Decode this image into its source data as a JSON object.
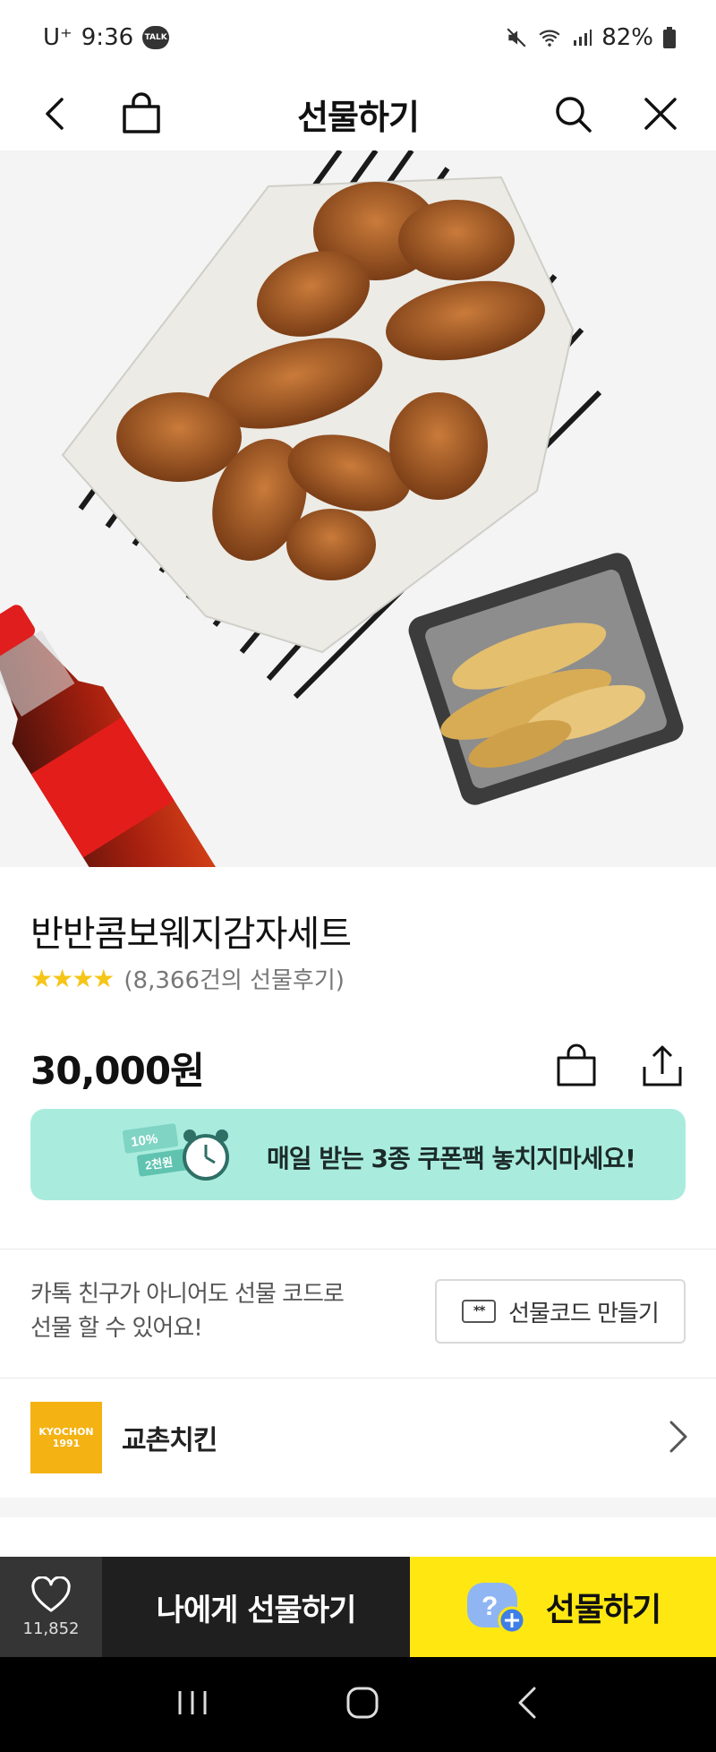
{
  "status_bar": {
    "carrier": "U⁺",
    "time": "9:36",
    "talk_badge": "TALK",
    "battery": "82%"
  },
  "header": {
    "title": "선물하기"
  },
  "product": {
    "name": "반반콤보웨지감자세트",
    "stars": "★★★★",
    "review_count": "(8,366건의 선물후기)",
    "price": "30,000원"
  },
  "coupon": {
    "text": "매일 받는 3종 쿠폰팩 놓치지마세요!",
    "tag1": "10%",
    "tag2": "2천원"
  },
  "gift_code": {
    "desc_line1": "카톡 친구가 아니어도 선물 코드로",
    "desc_line2": "선물 할 수 있어요!",
    "button_label": "선물코드 만들기",
    "icon_text": "**"
  },
  "brand": {
    "logo_line1": "KYOCHON",
    "logo_line2": "1991",
    "name": "교촌치킨"
  },
  "bottom_bar": {
    "like_count": "11,852",
    "self_gift_label": "나에게 선물하기",
    "gift_label": "선물하기"
  },
  "colors": {
    "coupon_bg": "#a9ecdd",
    "gift_button": "#ffe812",
    "self_gift_button": "#1f1f1f",
    "brand_logo": "#f4b213",
    "star": "#f5c518"
  }
}
